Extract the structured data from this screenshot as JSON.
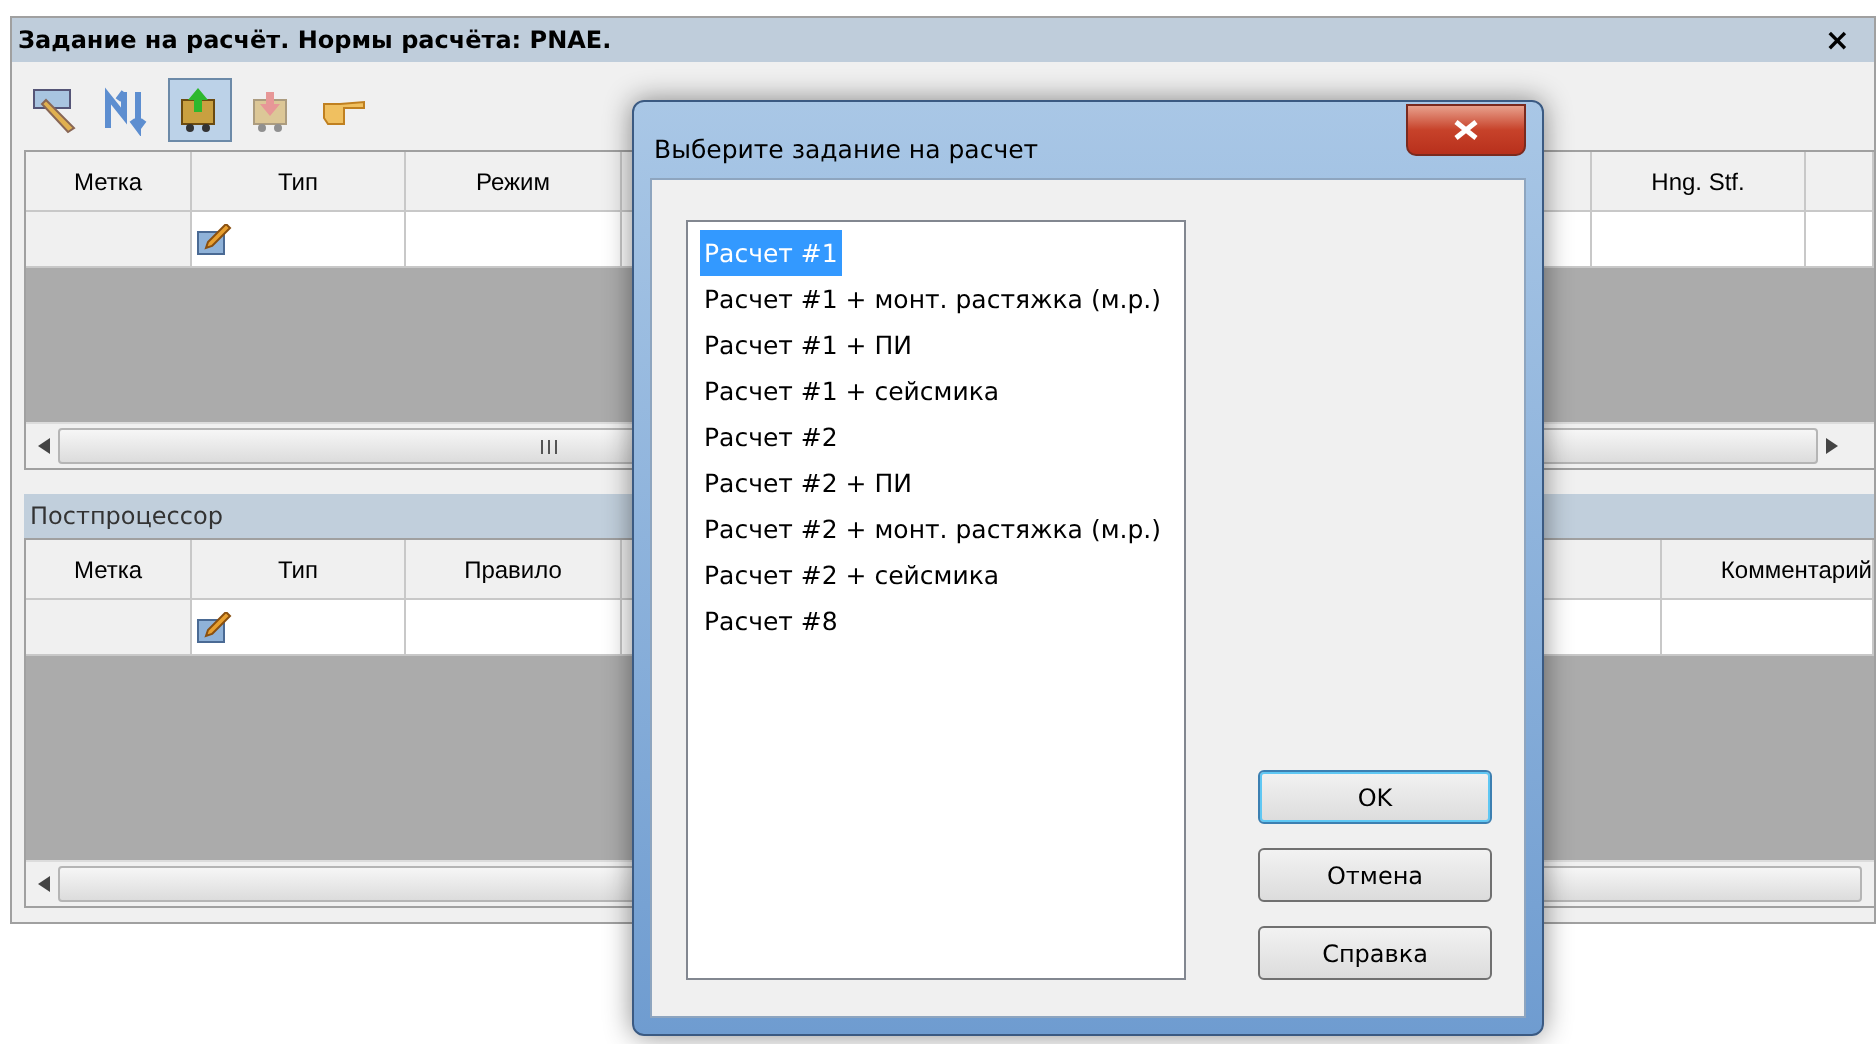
{
  "window": {
    "title": "Задание на расчёт. Нормы расчёта: PNAE.",
    "close": "×"
  },
  "toolbar": [
    {
      "kind": "pointer",
      "selected": false
    },
    {
      "kind": "sort",
      "selected": false
    },
    {
      "kind": "load",
      "selected": true
    },
    {
      "kind": "unload",
      "selected": false
    },
    {
      "kind": "hand",
      "selected": false
    }
  ],
  "tasks_grid": {
    "columns": [
      "Метка",
      "Тип",
      "Режим",
      "Hng. Stf."
    ]
  },
  "postprocessor": {
    "title": "Постпроцессор",
    "columns": [
      "Метка",
      "Тип",
      "Правило",
      "Комментарий"
    ]
  },
  "dialog": {
    "title": "Выберите задание на расчет",
    "items": [
      {
        "label": "Расчет #1",
        "selected": true
      },
      {
        "label": "Расчет #1 + монт. растяжка (м.р.)",
        "selected": false
      },
      {
        "label": "Расчет #1 + ПИ",
        "selected": false
      },
      {
        "label": "Расчет #1 + сейсмика",
        "selected": false
      },
      {
        "label": "Расчет #2",
        "selected": false
      },
      {
        "label": "Расчет #2 + ПИ",
        "selected": false
      },
      {
        "label": "Расчет #2 + монт. растяжка (м.р.)",
        "selected": false
      },
      {
        "label": "Расчет #2 + сейсмика",
        "selected": false
      },
      {
        "label": "Расчет #8",
        "selected": false
      }
    ],
    "buttons": [
      {
        "label": "OK",
        "focused": true
      },
      {
        "label": "Отмена",
        "focused": false
      },
      {
        "label": "Справка",
        "focused": false
      }
    ]
  }
}
